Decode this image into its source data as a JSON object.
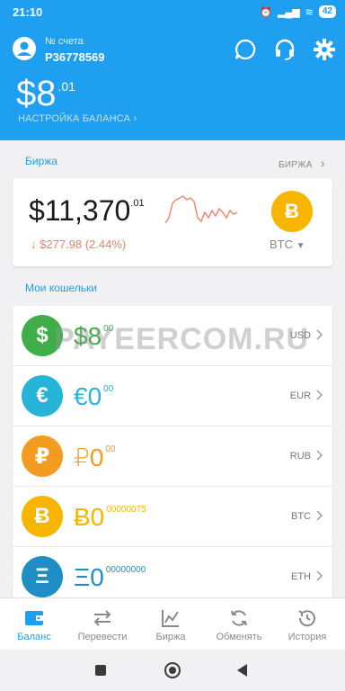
{
  "status": {
    "time": "21:10",
    "battery": "42"
  },
  "account": {
    "label": "№ счета",
    "number": "P36778569"
  },
  "balance": {
    "main": "$8",
    "cents": ".01",
    "setup_label": "НАСТРОЙКА БАЛАНСА"
  },
  "exchange": {
    "title": "Биржа",
    "link": "БИРЖА",
    "price_main": "$11,370",
    "price_cents": ".01",
    "change": "$277.98 (2.44%)",
    "currency": "BTC"
  },
  "wallets": {
    "title": "Мои кошельки",
    "items": [
      {
        "amount": "$8",
        "cents": "00",
        "currency": "USD",
        "color": "#3fae49",
        "symbol": "$"
      },
      {
        "amount": "€0",
        "cents": "00",
        "currency": "EUR",
        "color": "#26b5d8",
        "symbol": "€"
      },
      {
        "amount": "₽0",
        "cents": "00",
        "currency": "RUB",
        "color": "#f39c1f",
        "symbol": "₽"
      },
      {
        "amount": "Ƀ0",
        "cents": "00000075",
        "currency": "BTC",
        "color": "#f7b500",
        "symbol": "Ƀ"
      },
      {
        "amount": "Ξ0",
        "cents": "00000000",
        "currency": "ETH",
        "color": "#1f8ec4",
        "symbol": "Ξ"
      }
    ]
  },
  "watermark": "PAYEERCOM.RU",
  "nav": {
    "items": [
      {
        "label": "Баланс",
        "icon": "wallet-icon"
      },
      {
        "label": "Перевести",
        "icon": "transfer-icon"
      },
      {
        "label": "Биржа",
        "icon": "chart-icon"
      },
      {
        "label": "Обменять",
        "icon": "exchange-icon"
      },
      {
        "label": "История",
        "icon": "history-icon"
      }
    ]
  },
  "colors": {
    "primary": "#1f9ff0",
    "negative": "#e8826a",
    "btc": "#f7b500"
  }
}
